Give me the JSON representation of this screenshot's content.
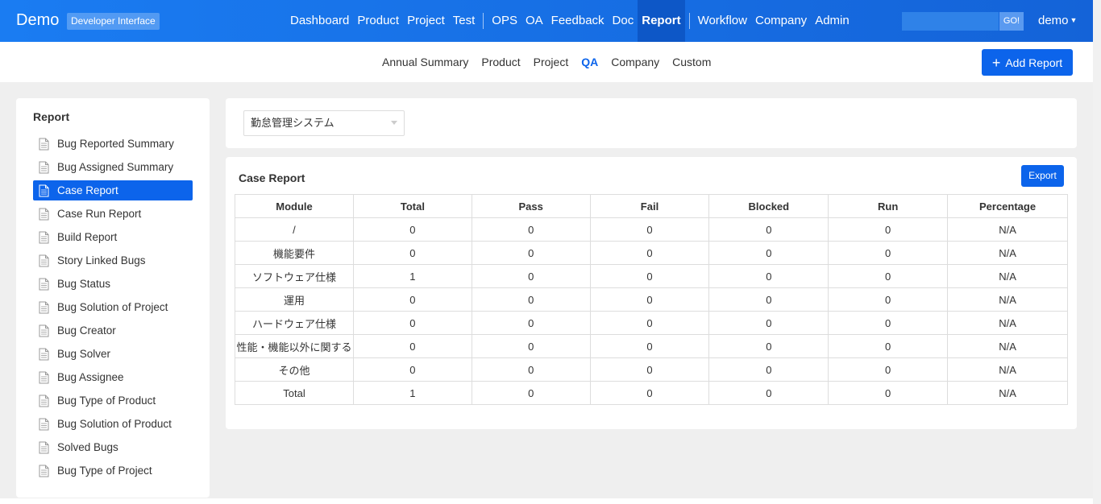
{
  "header": {
    "brand": "Demo",
    "badge": "Developer Interface",
    "nav": [
      "Dashboard",
      "Product",
      "Project",
      "Test",
      "|",
      "OPS",
      "OA",
      "Feedback",
      "Doc",
      "Report",
      "|",
      "Workflow",
      "Company",
      "Admin"
    ],
    "active_nav": "Report",
    "search_button": "GO!",
    "user": "demo"
  },
  "subnav": {
    "items": [
      "Annual Summary",
      "Product",
      "Project",
      "QA",
      "Company",
      "Custom"
    ],
    "active": "QA",
    "add_button": "Add Report"
  },
  "sidebar": {
    "title": "Report",
    "items": [
      "Bug Reported Summary",
      "Bug Assigned Summary",
      "Case Report",
      "Case Run Report",
      "Build Report",
      "Story Linked Bugs",
      "Bug Status",
      "Bug Solution of Project",
      "Bug Creator",
      "Bug Solver",
      "Bug Assignee",
      "Bug Type of Product",
      "Bug Solution of Product",
      "Solved Bugs",
      "Bug Type of Project"
    ],
    "active": "Case Report"
  },
  "filter": {
    "selected": "勤怠管理システム"
  },
  "report": {
    "title": "Case Report",
    "export_label": "Export",
    "columns": [
      "Module",
      "Total",
      "Pass",
      "Fail",
      "Blocked",
      "Run",
      "Percentage"
    ],
    "rows": [
      [
        "/",
        "0",
        "0",
        "0",
        "0",
        "0",
        "N/A"
      ],
      [
        "機能要件",
        "0",
        "0",
        "0",
        "0",
        "0",
        "N/A"
      ],
      [
        "ソフトウェア仕様",
        "1",
        "0",
        "0",
        "0",
        "0",
        "N/A"
      ],
      [
        "運用",
        "0",
        "0",
        "0",
        "0",
        "0",
        "N/A"
      ],
      [
        "ハードウェア仕様",
        "0",
        "0",
        "0",
        "0",
        "0",
        "N/A"
      ],
      [
        "性能・機能以外に関する",
        "0",
        "0",
        "0",
        "0",
        "0",
        "N/A"
      ],
      [
        "その他",
        "0",
        "0",
        "0",
        "0",
        "0",
        "N/A"
      ],
      [
        "Total",
        "1",
        "0",
        "0",
        "0",
        "0",
        "N/A"
      ]
    ]
  },
  "colors": {
    "header_bg": "#1a7cf2",
    "accent": "#0c64eb"
  }
}
